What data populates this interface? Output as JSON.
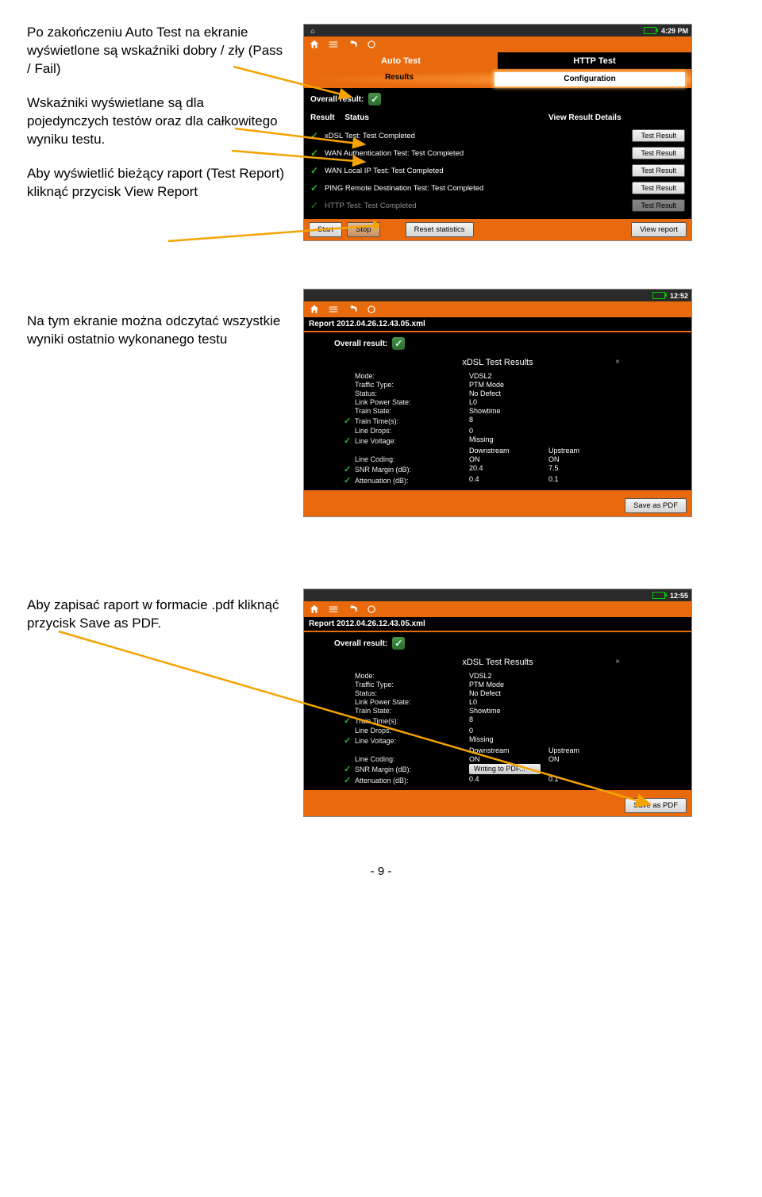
{
  "clock": {
    "s1": "4:29 PM",
    "s2": "12:52",
    "s3": "12:55"
  },
  "desc": {
    "p1a": "Po zakończeniu Auto Test na ekranie wyświetlone są wskaźniki dobry / zły (Pass / Fail)",
    "p1b": "Wskaźniki wyświetlane są dla pojedynczych testów oraz dla całkowitego wyniku testu.",
    "p1c": "Aby wyświetlić bieżący raport (Test Report) kliknąć przycisk View Report",
    "p2": "Na tym ekranie można odczytać wszystkie wyniki ostatnio wykonanego testu",
    "p3": "Aby zapisać raport w formacie .pdf kliknąć przycisk Save as PDF."
  },
  "tabs": {
    "auto": "Auto Test",
    "http": "HTTP Test",
    "results": "Results",
    "config": "Configuration"
  },
  "overall_label": "Overall result:",
  "headers": {
    "result": "Result",
    "status": "Status",
    "details": "View Result Details"
  },
  "tests": [
    {
      "name": "xDSL Test: Test Completed"
    },
    {
      "name": "WAN Authentication Test: Test Completed"
    },
    {
      "name": "WAN Local IP Test: Test Completed"
    },
    {
      "name": "PING Remote Destination Test: Test Completed"
    },
    {
      "name": "HTTP Test: Test Completed"
    }
  ],
  "btn": {
    "test_result": "Test Result",
    "start": "Start",
    "stop": "Stop",
    "reset": "Reset statistics",
    "view_report": "View report",
    "save_pdf": "Save as PDF",
    "writing": "Writing to PDF..."
  },
  "report_title": "Report 2012.04.26.12.43.05.xml",
  "xdsl_title": "xDSL Test Results",
  "params": [
    {
      "label": "Mode:",
      "v1": "VDSL2",
      "chk": ""
    },
    {
      "label": "Traffic Type:",
      "v1": "PTM Mode",
      "chk": ""
    },
    {
      "label": "Status:",
      "v1": "No Defect",
      "chk": ""
    },
    {
      "label": "Link Power State:",
      "v1": "L0",
      "chk": ""
    },
    {
      "label": "Train State:",
      "v1": "Showtime",
      "chk": ""
    },
    {
      "label": "Train Time(s):",
      "v1": "8",
      "chk": "✓"
    },
    {
      "label": "Line Drops:",
      "v1": "0",
      "chk": ""
    },
    {
      "label": "Line Voltage:",
      "v1": "Missing",
      "chk": "✓"
    },
    {
      "label": "",
      "v1": "Downstream",
      "v2": "Upstream",
      "chk": ""
    },
    {
      "label": "Line Coding:",
      "v1": "ON",
      "v2": "ON",
      "chk": ""
    },
    {
      "label": "SNR Margin (dB):",
      "v1": "20.4",
      "v2": "7.5",
      "chk": "✓"
    },
    {
      "label": "Attenuation (dB):",
      "v1": "0.4",
      "v2": "0.1",
      "chk": "✓"
    }
  ],
  "footer": "- 9 -"
}
